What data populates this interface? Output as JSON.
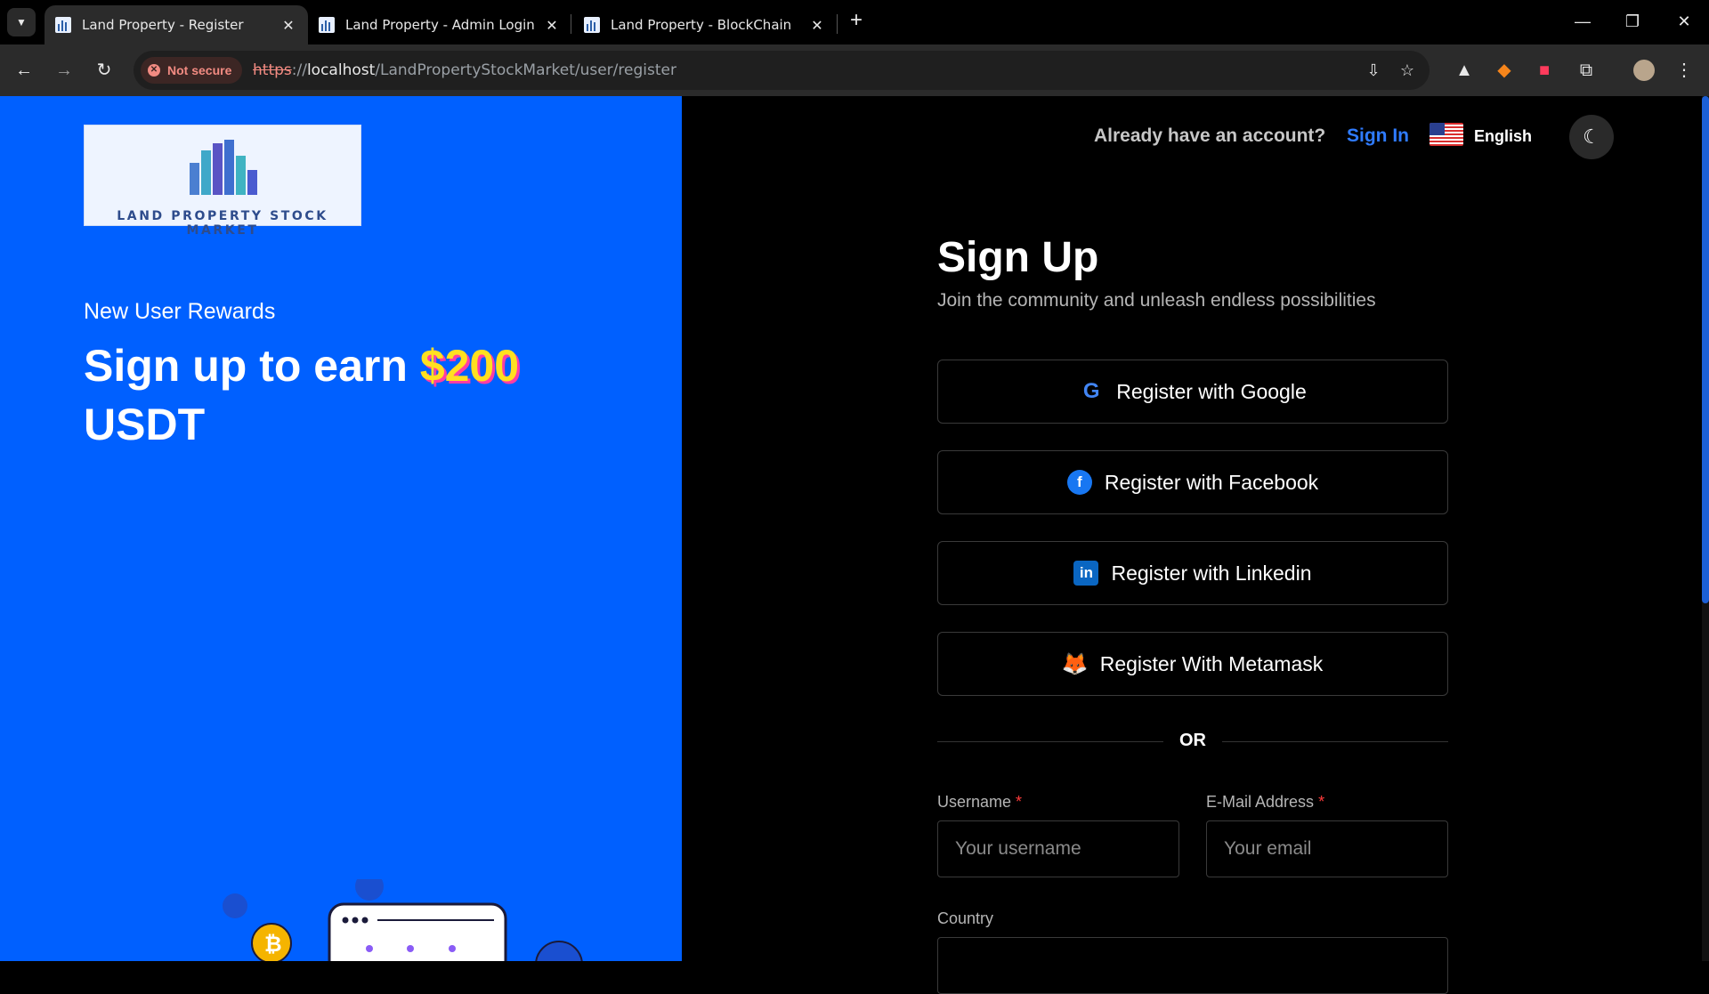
{
  "browser": {
    "tabs": [
      {
        "title": "Land Property - Register",
        "active": true
      },
      {
        "title": "Land Property - Admin Login",
        "active": false
      },
      {
        "title": "Land Property - BlockChain",
        "active": false
      }
    ],
    "security_chip": "Not secure",
    "url": {
      "scheme": "https",
      "separator": "://",
      "host": "localhost",
      "path": "/LandPropertyStockMarket/user/register"
    }
  },
  "left": {
    "logo_text": "LAND PROPERTY STOCK MARKET",
    "rewards_label": "New User Rewards",
    "headline_prefix": "Sign up to earn",
    "headline_amount": "$200",
    "headline_suffix": "USDT"
  },
  "header": {
    "already_text": "Already have an account?",
    "signin_label": "Sign In",
    "language": "English"
  },
  "form": {
    "title": "Sign Up",
    "subtitle": "Join the community and unleash endless possibilities",
    "social_buttons": [
      {
        "label": "Register with Google",
        "icon": "google-icon"
      },
      {
        "label": "Register with Facebook",
        "icon": "facebook-icon"
      },
      {
        "label": "Register with Linkedin",
        "icon": "linkedin-icon"
      },
      {
        "label": "Register With Metamask",
        "icon": "metamask-icon"
      }
    ],
    "or_text": "OR",
    "username": {
      "label": "Username",
      "required": "*",
      "placeholder": "Your username",
      "value": ""
    },
    "email": {
      "label": "E-Mail Address",
      "required": "*",
      "placeholder": "Your email",
      "value": ""
    },
    "country": {
      "label": "Country"
    }
  },
  "colors": {
    "left_bg": "#0060ff",
    "accent_link": "#2f7bff",
    "amount": "#ffe020",
    "amount_shadow": "#ff3da4",
    "required": "#ff3b3b"
  }
}
